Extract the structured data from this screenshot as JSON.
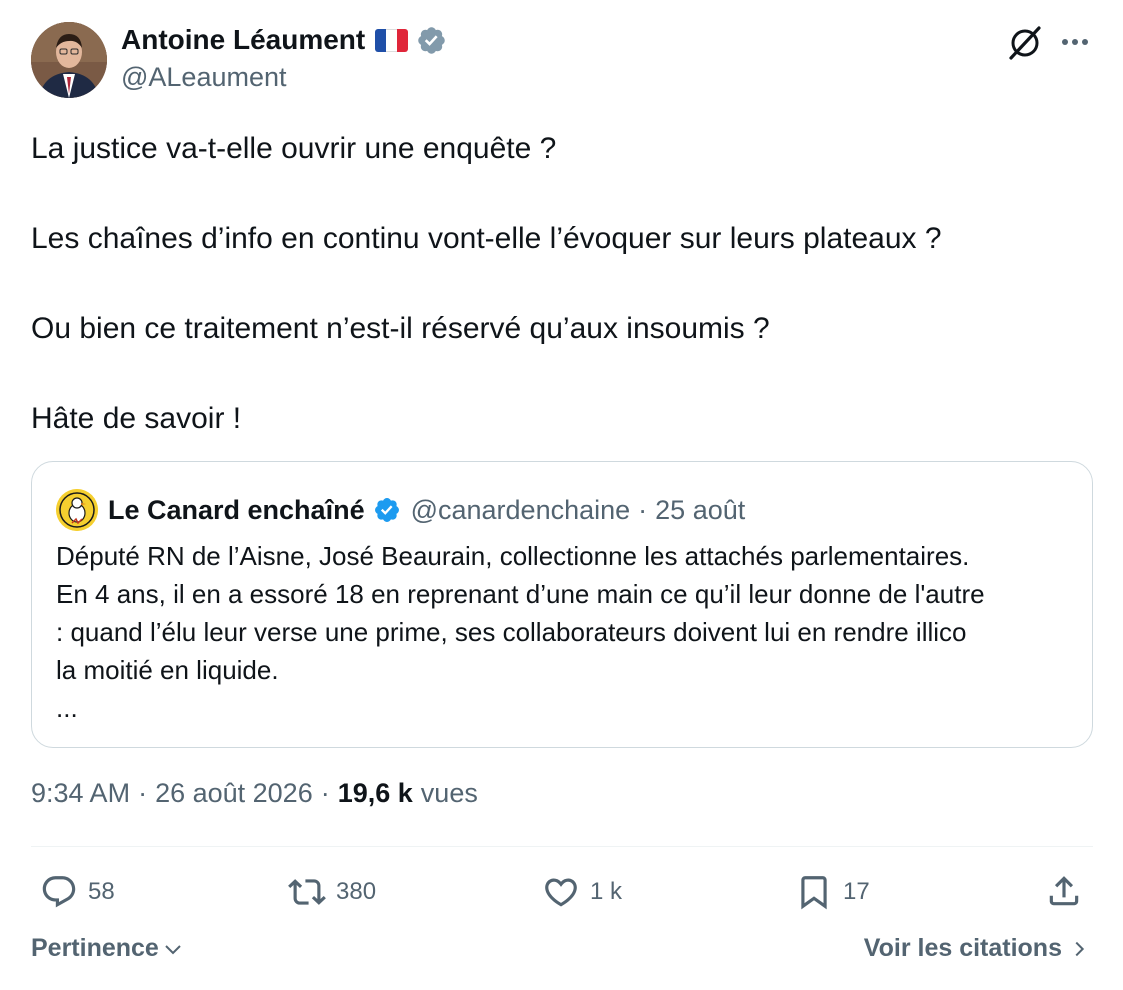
{
  "author": {
    "name": "Antoine Léaument",
    "handle": "@ALeaument"
  },
  "tweet_lines": [
    "La justice va-t-elle ouvrir une enquête ?",
    "",
    "Les chaînes d’info en continu vont-elle l’évoquer sur leurs plateaux ?",
    "",
    "Ou bien ce traitement n’est-il réservé qu’aux insoumis ?",
    "",
    "Hâte de savoir !"
  ],
  "quote": {
    "name": "Le Canard enchaîné",
    "handle": "@canardenchaine",
    "separator": "·",
    "date": "25 août",
    "lines": [
      "Député RN de l’Aisne, José Beaurain, collectionne les attachés parlementaires.",
      "En 4 ans, il en a essoré 18 en reprenant d’une main ce qu’il leur donne de l'autre",
      ": quand l’élu leur verse une prime, ses collaborateurs doivent lui en rendre illico",
      "la moitié en liquide.",
      "..."
    ]
  },
  "meta": {
    "time": "9:34 AM",
    "sep": "·",
    "date": "26 août 2026",
    "views_count": "19,6 k",
    "views_label": "vues"
  },
  "actions": {
    "replies": "58",
    "reposts": "380",
    "likes": "1 k",
    "bookmarks": "17"
  },
  "footer": {
    "sort_label": "Pertinence",
    "quotes_label": "Voir les citations"
  },
  "colors": {
    "text": "#0f1419",
    "secondary": "#536471",
    "verified": "#1d9bf0",
    "border": "#cfd9de"
  },
  "icons": {
    "verified": "verified-badge-icon",
    "grok": "grok-icon",
    "more": "more-icon",
    "reply": "reply-icon",
    "repost": "repost-icon",
    "like": "like-icon",
    "bookmark": "bookmark-icon",
    "share": "share-icon"
  }
}
